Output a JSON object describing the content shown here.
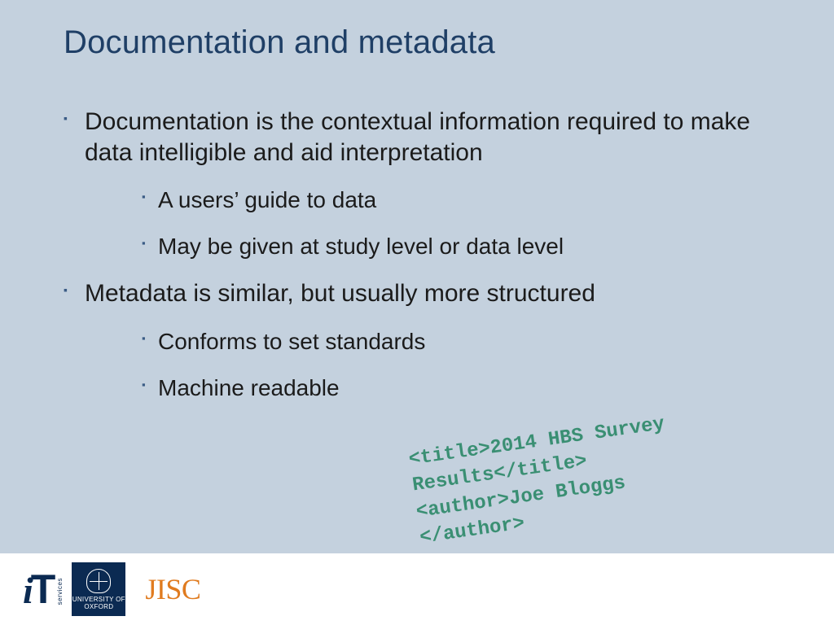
{
  "slide": {
    "title": "Documentation and metadata",
    "bullets": [
      {
        "level": 1,
        "text": "Documentation is the contextual information required to make data intelligible and aid interpretation"
      },
      {
        "level": 2,
        "text": "A users’ guide to data"
      },
      {
        "level": 2,
        "text": "May be given at study level or data level"
      },
      {
        "level": 1,
        "text": "Metadata is similar, but usually more structured"
      },
      {
        "level": 2,
        "text": "Conforms to set standards"
      },
      {
        "level": 2,
        "text": "Machine readable"
      }
    ],
    "xml_snippet": {
      "line1": "<title>2014 HBS Survey Results</title>",
      "line2": "<author>Joe Bloggs",
      "line3": "</author>"
    },
    "logos": {
      "it_i": "i",
      "it_T": "T",
      "it_services": "services",
      "ox_line1": "UNIVERSITY OF",
      "ox_line2": "OXFORD",
      "jisc": "JISC"
    }
  }
}
